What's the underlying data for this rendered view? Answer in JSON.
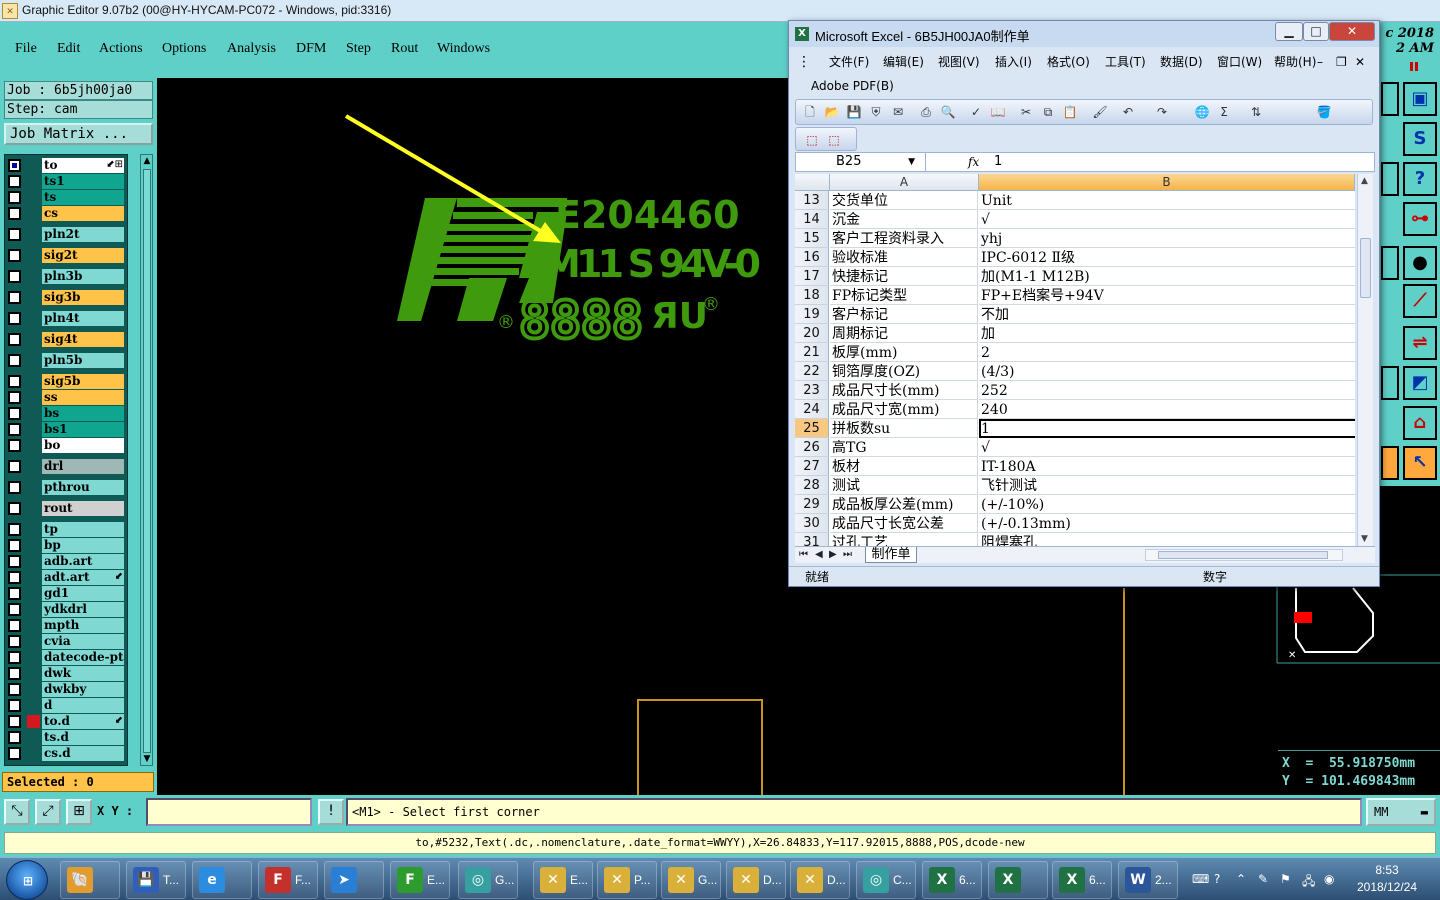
{
  "editor": {
    "title": "Graphic Editor 9.07b2 (00@HY-HYCAM-PC072 - Windows, pid:3316)",
    "menu": [
      "File",
      "Edit",
      "Actions",
      "Options",
      "Analysis",
      "DFM",
      "Step",
      "Rout",
      "Windows"
    ],
    "job_line": "Job : 6b5jh00ja0",
    "step_line": "Step: cam",
    "job_matrix_label": "Job Matrix ...",
    "selected_line": "Selected : 0",
    "layers": [
      {
        "name": "to",
        "color": "#ffffff",
        "checked": true,
        "mark": "⬋⊞"
      },
      {
        "name": "ts1",
        "color": "#0fa58e"
      },
      {
        "name": "ts",
        "color": "#0fa58e"
      },
      {
        "name": "cs",
        "color": "#ffc34a"
      },
      {
        "name": "pln2t",
        "color": "#7fd8d2"
      },
      {
        "name": "sig2t",
        "color": "#ffc34a"
      },
      {
        "name": "pln3b",
        "color": "#7fd8d2"
      },
      {
        "name": "sig3b",
        "color": "#ffc34a"
      },
      {
        "name": "pln4t",
        "color": "#7fd8d2"
      },
      {
        "name": "sig4t",
        "color": "#ffc34a"
      },
      {
        "name": "pln5b",
        "color": "#7fd8d2"
      },
      {
        "name": "sig5b",
        "color": "#ffc34a"
      },
      {
        "name": "ss",
        "color": "#ffc34a"
      },
      {
        "name": "bs",
        "color": "#0fa58e"
      },
      {
        "name": "bs1",
        "color": "#0fa58e"
      },
      {
        "name": "bo",
        "color": "#ffffff"
      },
      {
        "name": "drl",
        "color": "#9fb7b5"
      },
      {
        "name": "pthrou",
        "color": "#7fd8d2"
      },
      {
        "name": "rout",
        "color": "#d0d0d0"
      },
      {
        "name": "tp",
        "color": "#7fd8d2"
      },
      {
        "name": "bp",
        "color": "#7fd8d2"
      },
      {
        "name": "adb.art",
        "color": "#7fd8d2"
      },
      {
        "name": "adt.art",
        "color": "#7fd8d2",
        "mark": "⬋"
      },
      {
        "name": "gd1",
        "color": "#7fd8d2"
      },
      {
        "name": "ydkdrl",
        "color": "#7fd8d2"
      },
      {
        "name": "mpth",
        "color": "#7fd8d2"
      },
      {
        "name": "cvia",
        "color": "#7fd8d2"
      },
      {
        "name": "datecode-pt",
        "color": "#7fd8d2"
      },
      {
        "name": "dwk",
        "color": "#7fd8d2"
      },
      {
        "name": "dwkby",
        "color": "#7fd8d2"
      },
      {
        "name": "d",
        "color": "#7fd8d2"
      },
      {
        "name": "to.d",
        "color": "#7fd8d2",
        "swatch": true,
        "mark": "⬋"
      },
      {
        "name": "ts.d",
        "color": "#7fd8d2"
      },
      {
        "name": "cs.d",
        "color": "#7fd8d2"
      }
    ],
    "xy_label": "X Y :",
    "xy_value": "",
    "prompt": "<M1> - Select first corner",
    "units": "MM",
    "status": "to,#5232,Text(.dc,.nomenclature,.date_format=WWYY),X=26.84833,Y=117.92015,8888,POS,dcode-new",
    "coords_x": "X  =  55.918750mm",
    "coords_y": "Y  = 101.469843mm",
    "header_date_line1": "c 2018",
    "header_date_line2": "2 AM",
    "canvas": {
      "marking_line1": "E204460",
      "marking_line2": "M11 S 94V-0",
      "marking_line3": "8888",
      "registered": "®",
      "ul_mark": "ЯU",
      "ink_color": "#3f9a0e",
      "arrow_color": "#ffff22",
      "outline_color": "#c7931f"
    }
  },
  "excel": {
    "title": "Microsoft Excel - 6B5JH00JA0制作单",
    "menu": [
      "文件(F)",
      "编辑(E)",
      "视图(V)",
      "插入(I)",
      "格式(O)",
      "工具(T)",
      "数据(D)",
      "窗口(W)",
      "帮助(H)"
    ],
    "menu2": "Adobe PDF(B)",
    "name_box": "B25",
    "fx": "fx",
    "formula_value": "1",
    "col_a": "A",
    "col_b": "B",
    "rows": [
      {
        "n": "13",
        "a": "交货单位",
        "b": "Unit"
      },
      {
        "n": "14",
        "a": "沉金",
        "b": "√"
      },
      {
        "n": "15",
        "a": "客户工程资料录入",
        "b": "yhj"
      },
      {
        "n": "16",
        "a": "验收标准",
        "b": "IPC-6012 Ⅱ级"
      },
      {
        "n": "17",
        "a": "快捷标记",
        "b": "加(M1-1 M12B)"
      },
      {
        "n": "18",
        "a": "FP标记类型",
        "b": "FP+E档案号+94V"
      },
      {
        "n": "19",
        "a": "客户标记",
        "b": "不加"
      },
      {
        "n": "20",
        "a": "周期标记",
        "b": "加"
      },
      {
        "n": "21",
        "a": "板厚(mm)",
        "b": "2"
      },
      {
        "n": "22",
        "a": "铜箔厚度(OZ)",
        "b": "(4/3)"
      },
      {
        "n": "23",
        "a": "成品尺寸长(mm)",
        "b": "252"
      },
      {
        "n": "24",
        "a": "成品尺寸宽(mm)",
        "b": "240"
      },
      {
        "n": "25",
        "a": "拼板数su",
        "b": "1"
      },
      {
        "n": "26",
        "a": "高TG",
        "b": "√"
      },
      {
        "n": "27",
        "a": "板材",
        "b": "IT-180A"
      },
      {
        "n": "28",
        "a": "测试",
        "b": "飞针测试"
      },
      {
        "n": "29",
        "a": "成品板厚公差(mm)",
        "b": "(+/-10%)"
      },
      {
        "n": "30",
        "a": "成品尺寸长宽公差",
        "b": "(+/-0.13mm)"
      },
      {
        "n": "31",
        "a": "过孔工艺",
        "b": "阻焊塞孔"
      }
    ],
    "sheet_tab": "制作单",
    "status_ready": "就绪",
    "status_mode": "数字"
  },
  "taskbar": {
    "clock_time": "8:53",
    "clock_date": "2018/12/24",
    "tasks": [
      {
        "label": "",
        "icon": "shell-icon",
        "color": "#e29b2f"
      },
      {
        "label": "T...",
        "icon": "save-icon",
        "color": "#2f5fb8"
      },
      {
        "label": "",
        "icon": "ie-icon",
        "color": "#2b8ce0"
      },
      {
        "label": "F...",
        "icon": "f-icon",
        "color": "#c4302b"
      },
      {
        "label": "",
        "icon": "bird-icon",
        "color": "#2a7fd4"
      },
      {
        "label": "E...",
        "icon": "p-icon",
        "color": "#2d9b2d"
      },
      {
        "label": "G...",
        "icon": "genesis-icon",
        "color": "#36a0a0"
      },
      {
        "label": "E...",
        "icon": "excel-x-icon",
        "color": "#d9b13a"
      },
      {
        "label": "P...",
        "icon": "excel-x-icon",
        "color": "#d9b13a"
      },
      {
        "label": "G...",
        "icon": "excel-x-icon",
        "color": "#d9b13a"
      },
      {
        "label": "D...",
        "icon": "excel-x-icon",
        "color": "#d9b13a"
      },
      {
        "label": "D...",
        "icon": "excel-x-icon",
        "color": "#d9b13a"
      },
      {
        "label": "C...",
        "icon": "genesis-icon",
        "color": "#36a0a0"
      },
      {
        "label": "6...",
        "icon": "excel-icon",
        "color": "#207245"
      },
      {
        "label": "",
        "icon": "excel-icon",
        "color": "#207245"
      },
      {
        "label": "6...",
        "icon": "excel-icon",
        "color": "#207245"
      },
      {
        "label": "2...",
        "icon": "word-icon",
        "color": "#2b579a"
      }
    ]
  }
}
